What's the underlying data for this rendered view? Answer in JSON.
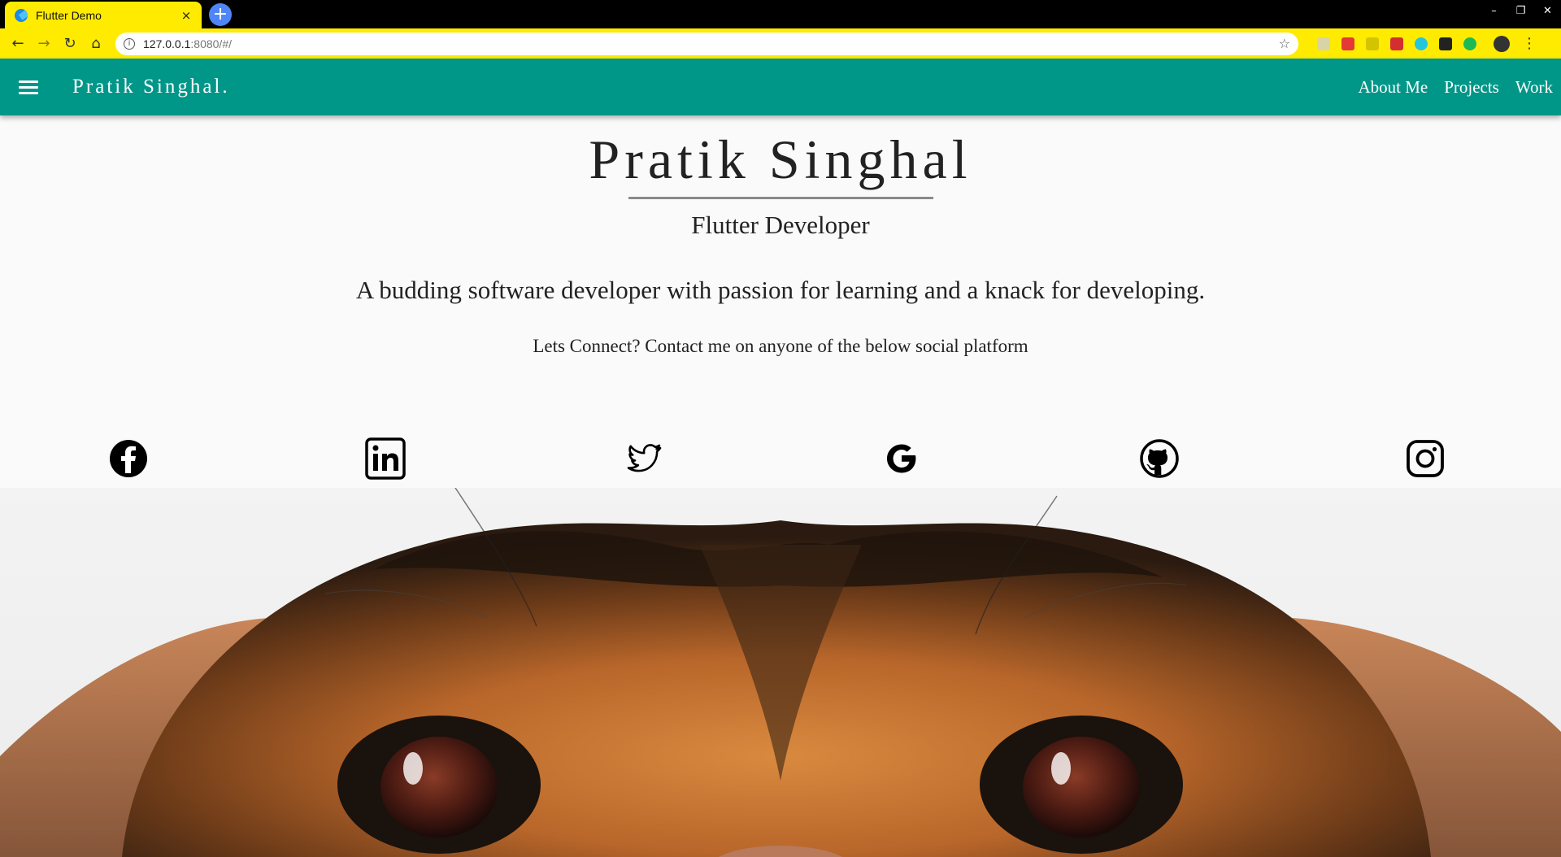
{
  "browser": {
    "tab_title": "Flutter Demo",
    "tab_close": "×",
    "new_tab": "+",
    "url_host": "127.0.0.1",
    "url_path": ":8080/#/",
    "window_controls": [
      "–",
      "❐",
      "✕"
    ]
  },
  "appbar": {
    "brand": "Pratik Singhal.",
    "nav": [
      "About Me",
      "Projects",
      "Work"
    ],
    "color": "#009688"
  },
  "hero": {
    "name": "Pratik Singhal",
    "role": "Flutter Developer",
    "tagline": "A budding software developer with passion for learning and a knack for developing.",
    "connect": "Lets Connect? Contact me on anyone of the below social platform"
  },
  "social": [
    "facebook-icon",
    "linkedin-icon",
    "twitter-icon",
    "google-icon",
    "github-icon",
    "instagram-icon"
  ]
}
